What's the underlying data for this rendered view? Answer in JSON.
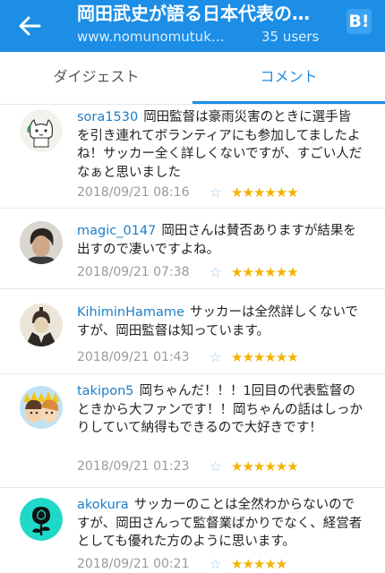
{
  "header": {
    "title": "岡田武史が語る日本代表の…",
    "url": "www.nomunomutuk…",
    "users": "35 users",
    "hatena_label": "B!"
  },
  "tabs": [
    {
      "label": "ダイジェスト",
      "active": false
    },
    {
      "label": "コメント",
      "active": true
    }
  ],
  "comments": [
    {
      "user": "sora1530",
      "text": "岡田監督は豪雨災害のときに選手皆を引き連れてボランティアにも参加してましたよね！サッカー全く詳しくないですが、すごい人だなぁと思いました",
      "date": "2018/09/21 08:16",
      "stars": "★★★★★★",
      "avatar": "cat-avatar"
    },
    {
      "user": "magic_0147",
      "text": "岡田さんは賛否ありますが結果を出すので凄いですよね。",
      "date": "2018/09/21 07:38",
      "stars": "★★★★★★",
      "avatar": "person-photo-avatar"
    },
    {
      "user": "KihiminHamame",
      "text": "サッカーは全然詳しくないですが、岡田監督は知っています。",
      "date": "2018/09/21 01:43",
      "stars": "★★★★★★",
      "avatar": "portrait-avatar"
    },
    {
      "user": "takipon5",
      "text": "岡ちゃんだ！！！1回目の代表監督のときから大ファンです！！岡ちゃんの話はしっかりしていて納得もできるので大好きです！",
      "date": "2018/09/21 01:23",
      "stars": "★★★★★★",
      "avatar": "illustration-avatar"
    },
    {
      "user": "akokura",
      "text": "サッカーのことは全然わからないのですが、岡田さんって監督業ばかりでなく、経営者としても優れた方のように思います。",
      "date": "2018/09/21 00:21",
      "stars": "★★★★★",
      "avatar": "rose-avatar"
    }
  ],
  "colors": {
    "primary": "#1c8ee6",
    "star": "#f2b300",
    "username": "#1c7fc9"
  }
}
